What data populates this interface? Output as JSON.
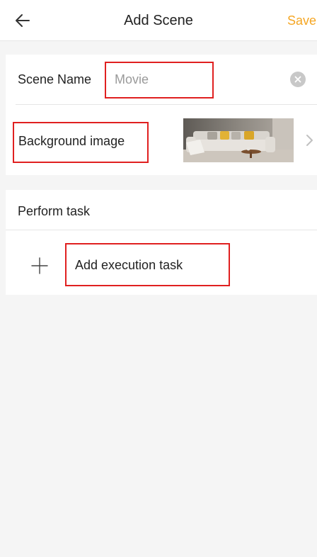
{
  "header": {
    "title": "Add Scene",
    "save_label": "Save",
    "back_icon": "arrow-left-icon",
    "accent_color": "#f5a623"
  },
  "scene": {
    "name_label": "Scene Name",
    "name_value": "Movie",
    "clear_icon": "clear-circle-icon",
    "background_label": "Background image",
    "background_thumbnail": "living-room-sofa-image",
    "chevron_icon": "chevron-right-icon"
  },
  "tasks": {
    "section_label": "Perform task",
    "add_label": "Add execution task",
    "add_icon": "plus-icon"
  },
  "highlight_color": "#e02020"
}
